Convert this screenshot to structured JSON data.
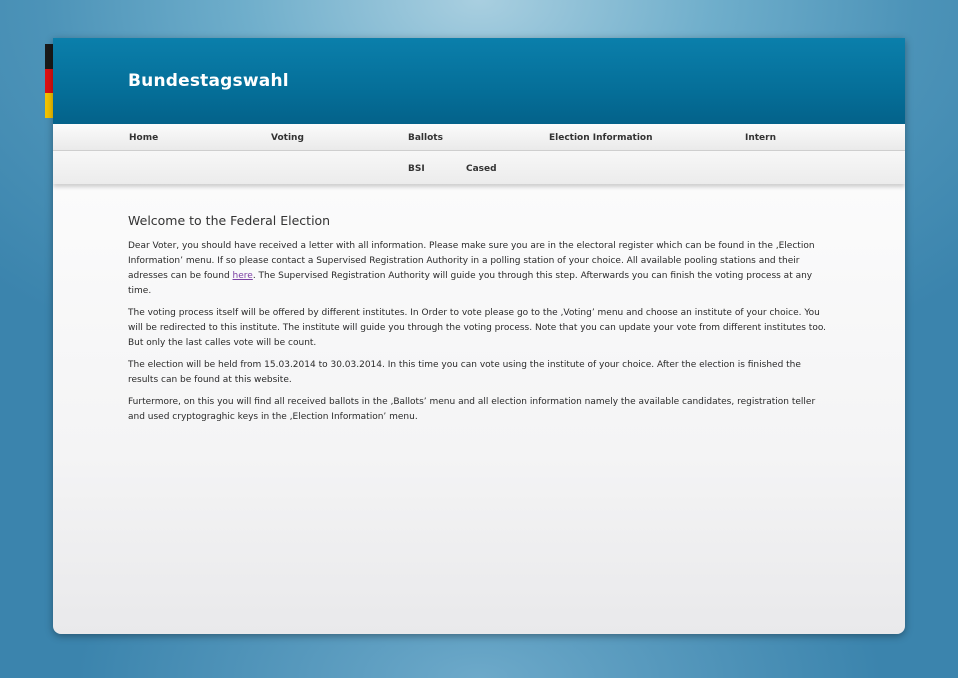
{
  "header": {
    "title": "Bundestagswahl",
    "flag_colors": [
      "#1a1a1a",
      "#dd1111",
      "#f5c400"
    ]
  },
  "nav": {
    "primary": [
      {
        "label": "Home"
      },
      {
        "label": "Voting"
      },
      {
        "label": "Ballots"
      },
      {
        "label": "Election Information"
      },
      {
        "label": "Intern"
      }
    ],
    "secondary": [
      {
        "label": "BSI"
      },
      {
        "label": "Cased"
      }
    ]
  },
  "content": {
    "heading": "Welcome to the Federal Election",
    "paragraphs": {
      "p1_before": "Dear Voter, you should have received a letter with all information. Please make sure you are in the electoral register which can be found in the ‚Election Information’ menu. If so please contact a Supervised Registration Authority in a polling station of your choice. All available pooling stations and their adresses can be found ",
      "p1_link": "here",
      "p1_after": ". The Supervised Registration Authority will guide you through this step. Afterwards you can finish the voting process at any time.",
      "p2": "The voting process itself will be offered by different institutes. In Order to vote please go to the ‚Voting’ menu and choose an institute of your choice. You will be redirected to this institute. The institute will guide you through the voting process. Note that you can update your vote from different institutes too. But only the last calles vote will be count.",
      "p3": "The election will be held from 15.03.2014 to 30.03.2014. In this time you can vote using the institute of your choice. After the election is finished the results can be found at this website.",
      "p4": "Furtermore, on this you will find all received ballots in the ‚Ballots’ menu and all election information namely the available candidates, registration teller and used cryptograghic keys in the ‚Election Information’ menu."
    }
  }
}
